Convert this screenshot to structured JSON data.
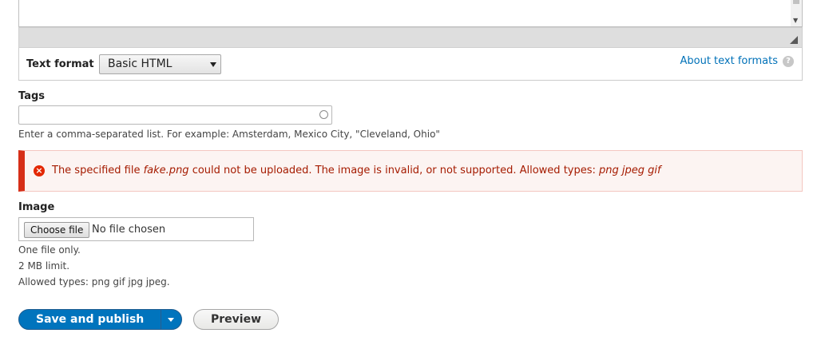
{
  "text_format": {
    "label": "Text format",
    "selected": "Basic HTML",
    "about_link": "About text formats",
    "help_icon": "?"
  },
  "tags": {
    "label": "Tags",
    "value": "",
    "description": "Enter a comma-separated list. For example: Amsterdam, Mexico City, \"Cleveland, Ohio\""
  },
  "error": {
    "icon": "×",
    "prefix": "The specified file ",
    "filename": "fake.png",
    "middle": " could not be uploaded. The image is invalid, or not supported. Allowed types: ",
    "types": "png jpeg gif",
    "color": "#d62f18"
  },
  "image": {
    "label": "Image",
    "choose_button": "Choose file",
    "status": "No file chosen",
    "help_lines": [
      "One file only.",
      "2 MB limit.",
      "Allowed types: png gif jpg jpeg."
    ]
  },
  "actions": {
    "save": "Save and publish",
    "preview": "Preview",
    "accent": "#0074bd"
  }
}
